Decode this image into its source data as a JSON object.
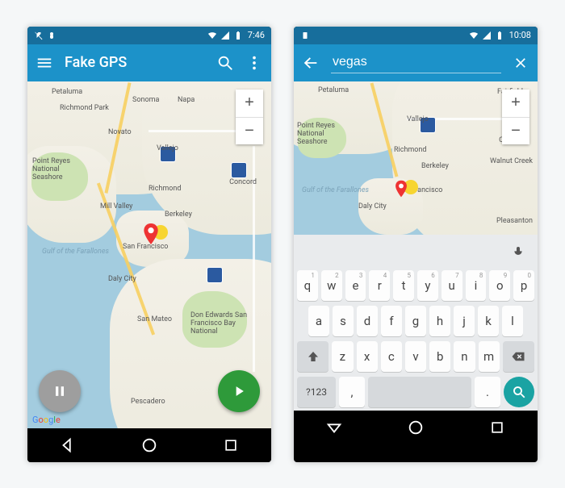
{
  "colors": {
    "statusbar": "#176e9c",
    "appbar": "#1c92c9",
    "sea": "#a3ccdf",
    "fab_play": "#2e9a3a",
    "fab_pause": "#9e9e9e",
    "search_key": "#1aa3a3"
  },
  "left": {
    "statusbar": {
      "time": "7:46"
    },
    "appbar": {
      "title": "Fake GPS"
    },
    "zoom": {
      "in": "+",
      "out": "−"
    },
    "google": [
      "G",
      "o",
      "o",
      "g",
      "l",
      "e"
    ],
    "cities": {
      "petaluma": "Petaluma",
      "richmond_park": "Richmond Park",
      "sonoma": "Sonoma",
      "napa": "Napa",
      "point_reyes": "Point Reyes National Seashore",
      "novato": "Novato",
      "vallejo": "Vallejo",
      "richmond": "Richmond",
      "mill_valley": "Mill Valley",
      "berkeley": "Berkeley",
      "san_francisco": "San Francisco",
      "concord": "Concord",
      "daly_city": "Daly City",
      "san_mateo": "San Mateo",
      "don_edwards": "Don Edwards San Francisco Bay National",
      "pescadero": "Pescadero",
      "gulf": "Gulf of the Farallones"
    }
  },
  "right": {
    "statusbar": {
      "time": "10:08"
    },
    "search": {
      "value": "vegas"
    },
    "zoom": {
      "in": "+",
      "out": "−"
    },
    "cities": {
      "petaluma": "Petaluma",
      "fairfield": "Fairfield",
      "vallejo": "Vallejo",
      "point_reyes": "Point Reyes National Seashore",
      "richmond": "Richmond",
      "concord": "Concord",
      "berkeley": "Berkeley",
      "walnut_creek": "Walnut Creek",
      "san_francisco": "San Francisco",
      "pleasanton": "Pleasanton",
      "daly_city": "Daly City",
      "gulf": "Gulf of the Farallones"
    },
    "keyboard": {
      "row1": [
        {
          "k": "q",
          "n": "1"
        },
        {
          "k": "w",
          "n": "2"
        },
        {
          "k": "e",
          "n": "3"
        },
        {
          "k": "r",
          "n": "4"
        },
        {
          "k": "t",
          "n": "5"
        },
        {
          "k": "y",
          "n": "6"
        },
        {
          "k": "u",
          "n": "7"
        },
        {
          "k": "i",
          "n": "8"
        },
        {
          "k": "o",
          "n": "9"
        },
        {
          "k": "p",
          "n": "0"
        }
      ],
      "row2": [
        "a",
        "s",
        "d",
        "f",
        "g",
        "h",
        "j",
        "k",
        "l"
      ],
      "row3": [
        "z",
        "x",
        "c",
        "v",
        "b",
        "n",
        "m"
      ],
      "row4": {
        "sym": "?123",
        "comma": ",",
        "period": "."
      }
    }
  }
}
